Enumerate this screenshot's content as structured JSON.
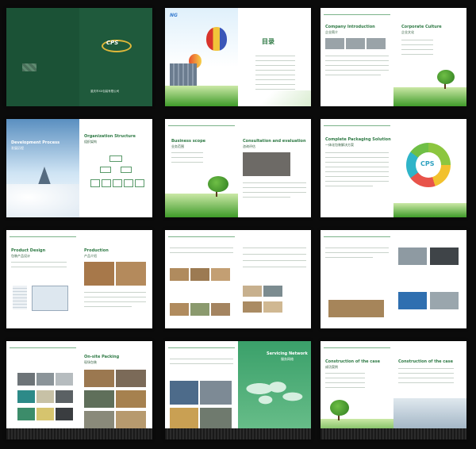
{
  "spreads": [
    {
      "id": "cover",
      "company_cn": "重庆市XX包装有限公司",
      "logo_text": "CPS"
    },
    {
      "id": "contents",
      "title": "目录",
      "logo_text": "NG"
    },
    {
      "id": "company",
      "title_en": "Company Introduction",
      "title_cn": "企业简介",
      "culture_en": "Corporate Culture",
      "culture_cn": "企业文化"
    },
    {
      "id": "development",
      "title_en": "Development Process",
      "title_cn": "发展历程",
      "org_en": "Organization Structure",
      "org_cn": "组织架构"
    },
    {
      "id": "business",
      "scope_en": "Business scope",
      "scope_cn": "业务范围",
      "consult_en": "Consultation and evaluation",
      "consult_cn": "咨询评估"
    },
    {
      "id": "solution",
      "title_en": "Complete Packaging Solution",
      "title_cn": "一体化包装解决方案",
      "cps": "CPS"
    },
    {
      "id": "design",
      "design_en": "Product Design",
      "design_cn": "包装产品设计",
      "prod_en": "Production",
      "prod_cn": "产品介绍"
    },
    {
      "id": "products1"
    },
    {
      "id": "products2"
    },
    {
      "id": "onsite",
      "title_en": "On-site Packing",
      "title_cn": "现场包装"
    },
    {
      "id": "network",
      "title_en": "Servicing Network",
      "title_cn": "服务网络"
    },
    {
      "id": "cases",
      "title_en": "Construction of the case",
      "title_cn": "成功案例"
    }
  ]
}
